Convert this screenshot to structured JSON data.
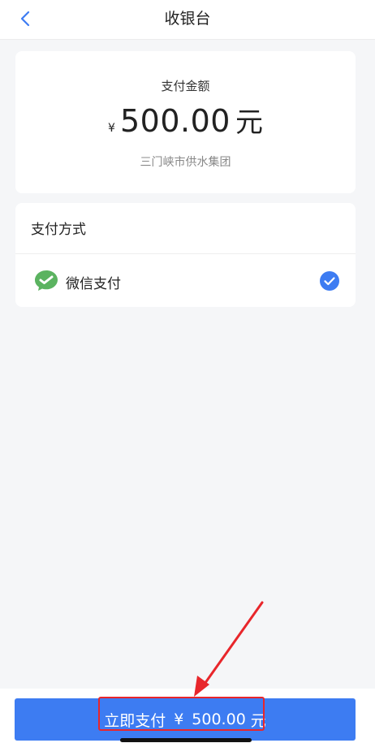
{
  "nav": {
    "title": "收银台",
    "back_icon": "chevron-left-icon"
  },
  "amount_card": {
    "label": "支付金额",
    "currency": "¥",
    "amount": "500.00",
    "unit": "元",
    "payee": "三门峡市供水集团"
  },
  "payment_methods": {
    "title": "支付方式",
    "items": [
      {
        "label": "微信支付",
        "icon": "wechat-icon",
        "selected": true
      }
    ]
  },
  "pay_button": {
    "label": "立即支付",
    "currency": "¥",
    "amount": "500.00",
    "unit": "元"
  },
  "colors": {
    "accent": "#3d7cf2",
    "wechat_green": "#5bb360",
    "annotation_red": "#e8262b",
    "page_bg": "#f5f6f8"
  }
}
